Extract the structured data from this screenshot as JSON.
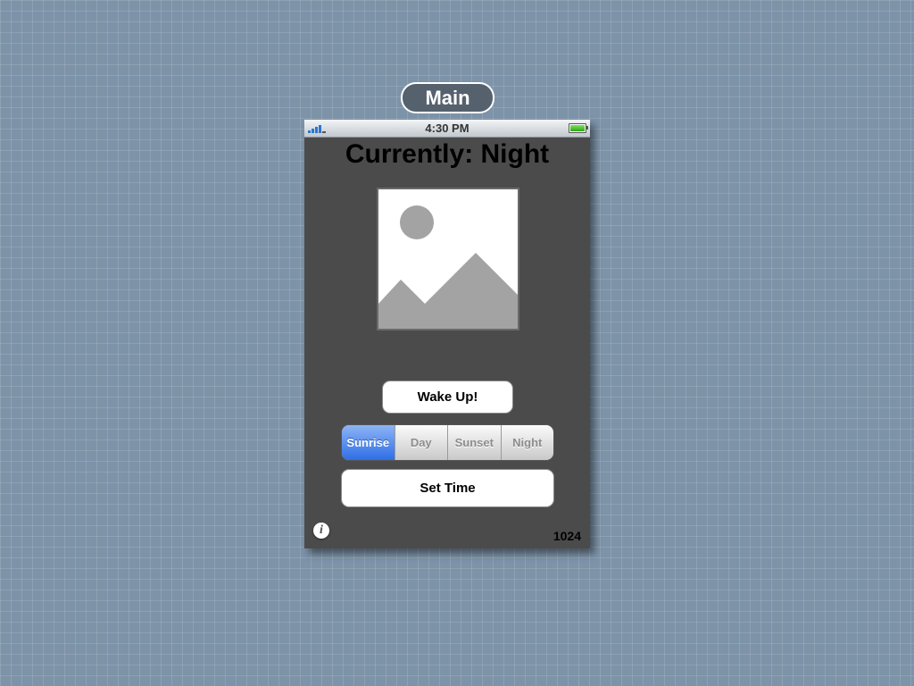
{
  "scene": {
    "label": "Main"
  },
  "status_bar": {
    "time": "4:30 PM",
    "signal_icon": "signal-bars-icon",
    "battery_icon": "battery-icon",
    "battery_level": 1.0
  },
  "header": {
    "title": "Currently: Night"
  },
  "image": {
    "icon": "image-placeholder-icon"
  },
  "buttons": {
    "wake": "Wake Up!",
    "set_time": "Set Time"
  },
  "segmented_control": {
    "segments": [
      "Sunrise",
      "Day",
      "Sunset",
      "Night"
    ],
    "selected_index": 0
  },
  "footer": {
    "info_icon": "info-icon",
    "info_glyph": "i",
    "count": "1024"
  },
  "colors": {
    "background": "#7d93a8",
    "device": "#4b4b4b",
    "selected_segment": "#2f6ee6",
    "battery": "#2fa51b"
  }
}
